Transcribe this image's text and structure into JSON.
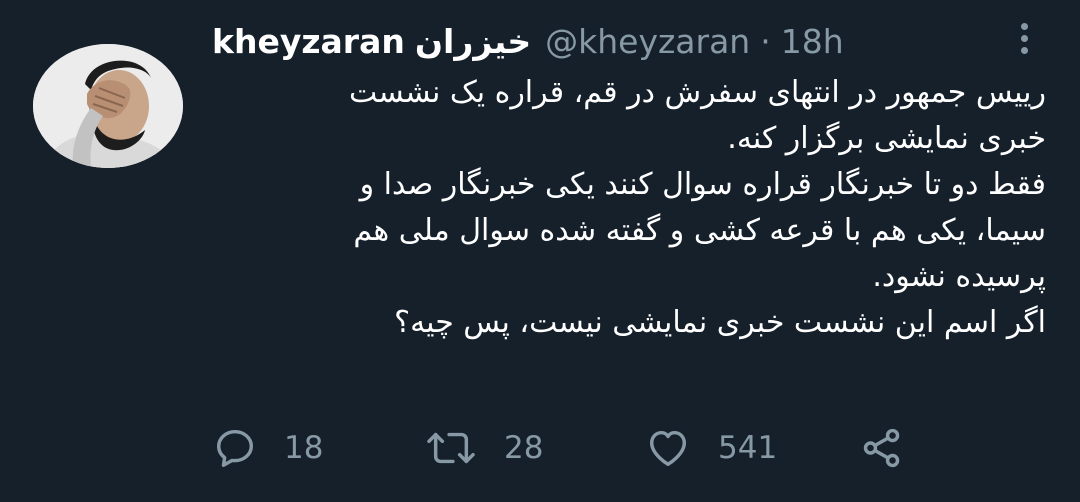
{
  "tweet": {
    "display_name": "kheyzaran",
    "display_name_fa": "خیزران",
    "handle": "@kheyzaran",
    "separator": "·",
    "time": "18h",
    "text_lines": [
      "رییس جمهور در انتهای سفرش در قم، قراره یک نشست",
      "خبری نمایشی برگزار کنه.",
      "فقط دو تا خبرنگار قراره سوال کنند یکی خبرنگار صدا و",
      "سیما، یکی هم با قرعه کشی و گفته شده سوال ملی هم",
      "پرسیده نشود.",
      "اگر اسم این نشست خبری نمایشی نیست، پس چیه؟"
    ]
  },
  "actions": {
    "reply": {
      "icon": "reply-icon",
      "count": "18"
    },
    "retweet": {
      "icon": "retweet-icon",
      "count": "28"
    },
    "like": {
      "icon": "heart-icon",
      "count": "541"
    },
    "share": {
      "icon": "share-icon"
    }
  },
  "colors": {
    "background": "#15202b",
    "text": "#ffffff",
    "secondary": "#8899a6"
  }
}
